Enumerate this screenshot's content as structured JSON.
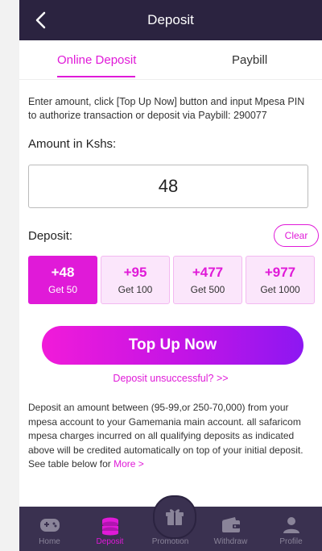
{
  "header": {
    "title": "Deposit"
  },
  "tabs": [
    {
      "label": "Online Deposit"
    },
    {
      "label": "Paybill"
    }
  ],
  "instructions": "Enter amount, click [Top Up Now] button and input Mpesa PIN to authorize transaction or deposit via Paybill: 290077",
  "amount": {
    "label": "Amount in Kshs:",
    "value": "48"
  },
  "deposit": {
    "label": "Deposit:",
    "clear_label": "Clear"
  },
  "options": [
    {
      "amount": "+48",
      "get": "Get 50"
    },
    {
      "amount": "+95",
      "get": "Get 100"
    },
    {
      "amount": "+477",
      "get": "Get 500"
    },
    {
      "amount": "+977",
      "get": "Get 1000"
    }
  ],
  "topup_label": "Top Up Now",
  "unsuccessful_link": "Deposit unsuccessful? >>",
  "description": "Deposit an amount between (95-99,or 250-70,000) from your mpesa account to your Gamemania main account. all safaricom mpesa charges incurred on all qualifying deposits as indicated above will be credited automatically on top of your initial deposit. See table below for",
  "more_link": "More >",
  "nav": [
    {
      "label": "Home",
      "icon": "gamepad-icon"
    },
    {
      "label": "Deposit",
      "icon": "coins-icon"
    },
    {
      "label": "Promotion",
      "icon": "gift-icon"
    },
    {
      "label": "Withdraw",
      "icon": "wallet-icon"
    },
    {
      "label": "Profile",
      "icon": "user-icon"
    }
  ],
  "colors": {
    "accent": "#e01ad8",
    "header_bg": "#2b2340",
    "nav_bg": "#3a3150"
  }
}
